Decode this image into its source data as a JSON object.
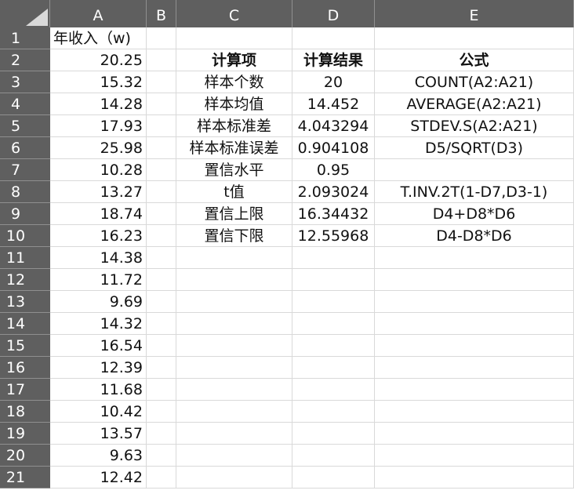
{
  "spreadsheet": {
    "columns": [
      "A",
      "B",
      "C",
      "D",
      "E"
    ],
    "rows": [
      {
        "n": "1",
        "A": "年收入（w)",
        "B": "",
        "C": "",
        "D": "",
        "E": ""
      },
      {
        "n": "2",
        "A": "20.25",
        "B": "",
        "C": "计算项",
        "D": "计算结果",
        "E": "公式"
      },
      {
        "n": "3",
        "A": "15.32",
        "B": "",
        "C": "样本个数",
        "D": "20",
        "E": "COUNT(A2:A21)"
      },
      {
        "n": "4",
        "A": "14.28",
        "B": "",
        "C": "样本均值",
        "D": "14.452",
        "E": "AVERAGE(A2:A21)"
      },
      {
        "n": "5",
        "A": "17.93",
        "B": "",
        "C": "样本标准差",
        "D": "4.043294",
        "E": "STDEV.S(A2:A21)"
      },
      {
        "n": "6",
        "A": "25.98",
        "B": "",
        "C": "样本标准误差",
        "D": "0.904108",
        "E": "D5/SQRT(D3)"
      },
      {
        "n": "7",
        "A": "10.28",
        "B": "",
        "C": "置信水平",
        "D": "0.95",
        "E": ""
      },
      {
        "n": "8",
        "A": "13.27",
        "B": "",
        "C": "t值",
        "D": "2.093024",
        "E": "T.INV.2T(1-D7,D3-1)"
      },
      {
        "n": "9",
        "A": "18.74",
        "B": "",
        "C": "置信上限",
        "D": "16.34432",
        "E": "D4+D8*D6"
      },
      {
        "n": "10",
        "A": "16.23",
        "B": "",
        "C": "置信下限",
        "D": "12.55968",
        "E": "D4-D8*D6"
      },
      {
        "n": "11",
        "A": "14.38",
        "B": "",
        "C": "",
        "D": "",
        "E": ""
      },
      {
        "n": "12",
        "A": "11.72",
        "B": "",
        "C": "",
        "D": "",
        "E": ""
      },
      {
        "n": "13",
        "A": "9.69",
        "B": "",
        "C": "",
        "D": "",
        "E": ""
      },
      {
        "n": "14",
        "A": "14.32",
        "B": "",
        "C": "",
        "D": "",
        "E": ""
      },
      {
        "n": "15",
        "A": "16.54",
        "B": "",
        "C": "",
        "D": "",
        "E": ""
      },
      {
        "n": "16",
        "A": "12.39",
        "B": "",
        "C": "",
        "D": "",
        "E": ""
      },
      {
        "n": "17",
        "A": "11.68",
        "B": "",
        "C": "",
        "D": "",
        "E": ""
      },
      {
        "n": "18",
        "A": "10.42",
        "B": "",
        "C": "",
        "D": "",
        "E": ""
      },
      {
        "n": "19",
        "A": "13.57",
        "B": "",
        "C": "",
        "D": "",
        "E": ""
      },
      {
        "n": "20",
        "A": "9.63",
        "B": "",
        "C": "",
        "D": "",
        "E": ""
      },
      {
        "n": "21",
        "A": "12.42",
        "B": "",
        "C": "",
        "D": "",
        "E": ""
      }
    ]
  },
  "colors": {
    "header_bg": "#5f5f5f",
    "header_text": "#ffffff",
    "grid_line": "#d9d9d9",
    "cell_text": "#111111"
  }
}
